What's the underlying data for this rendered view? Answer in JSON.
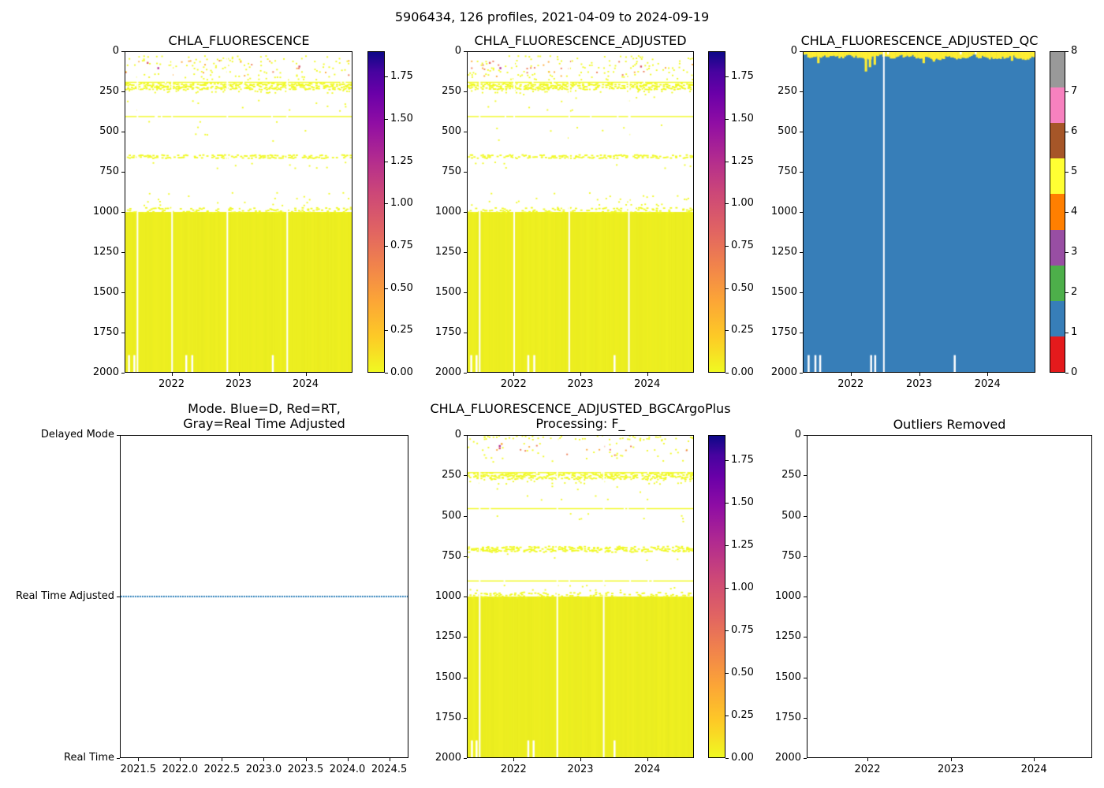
{
  "figure": {
    "suptitle": "5906434, 126 profiles, 2021-04-09 to 2024-09-19",
    "background": "#ffffff"
  },
  "colors": {
    "axis": "#000000",
    "heat_yellow": "#f0f921",
    "heat_block": "#eff021",
    "heat_stripe": "#dde41e",
    "qc_blue": "#377eb8",
    "qc_yellow": "#ffee33",
    "mode_blue": "#1f77b4",
    "plasma_stops": [
      [
        0,
        "#f0f921"
      ],
      [
        0.11,
        "#fdca26"
      ],
      [
        0.22,
        "#fca636"
      ],
      [
        0.33,
        "#f1844b"
      ],
      [
        0.44,
        "#e16462"
      ],
      [
        0.56,
        "#cc4778"
      ],
      [
        0.67,
        "#b12a90"
      ],
      [
        0.78,
        "#8f0da4"
      ],
      [
        0.87,
        "#6a00a8"
      ],
      [
        0.94,
        "#46039f"
      ],
      [
        1,
        "#0d0887"
      ]
    ],
    "set1": [
      "#e41a1c",
      "#377eb8",
      "#4daf4a",
      "#984ea3",
      "#ff7f00",
      "#ffff33",
      "#a65628",
      "#f781bf",
      "#999999"
    ]
  },
  "chart_data": [
    {
      "type": "heatmap",
      "title": "CHLA_FLUORESCENCE",
      "x_range": [
        2021.3,
        2024.7
      ],
      "y_range": [
        0,
        2000
      ],
      "n_profiles": 126,
      "seed": 11,
      "xticks": [
        2022,
        2023,
        2024
      ],
      "xtick_labels": [
        "2022",
        "2023",
        "2024"
      ],
      "yticks": [
        0,
        250,
        500,
        750,
        1000,
        1250,
        1500,
        1750,
        2000
      ],
      "ytick_labels": [
        "0",
        "250",
        "500",
        "750",
        "1000",
        "1250",
        "1500",
        "1750",
        "2000"
      ],
      "colorbar": {
        "vmin": 0,
        "vmax": 1.9,
        "tick_values": [
          0,
          0.25,
          0.5,
          0.75,
          1.0,
          1.25,
          1.5,
          1.75
        ],
        "tick_labels": [
          "0.00",
          "0.25",
          "0.50",
          "0.75",
          "1.00",
          "1.25",
          "1.50",
          "1.75"
        ],
        "colormap": "plasma_r"
      },
      "features": {
        "speck_bands": [
          {
            "y": [
              25,
              175
            ],
            "step": 14,
            "p": 0.09,
            "colors": [
              "#f0f921"
            ]
          },
          {
            "y": [
              55,
              150
            ],
            "step": 22,
            "p": 0.05,
            "colors": [
              "#fca636",
              "#ed7953",
              "#fca636"
            ]
          },
          {
            "y": [
              196,
              228
            ],
            "step": 10,
            "p": 0.55,
            "colors": [
              "#f0f921"
            ]
          },
          {
            "y": [
              228,
              250
            ],
            "step": 10,
            "p": 0.12,
            "colors": [
              "#f0f921"
            ]
          },
          {
            "y": [
              260,
              360
            ],
            "step": 20,
            "p": 0.02,
            "colors": [
              "#f0f921"
            ]
          },
          {
            "y": [
              430,
              560
            ],
            "step": 20,
            "p": 0.015,
            "colors": [
              "#f0f921"
            ]
          },
          {
            "y": [
              644,
              658
            ],
            "step": 12,
            "p": 0.55,
            "colors": [
              "#f0f921"
            ]
          },
          {
            "y": [
              690,
              735
            ],
            "step": 16,
            "p": 0.02,
            "colors": [
              "#f0f921"
            ]
          },
          {
            "y": [
              880,
              972
            ],
            "step": 18,
            "p": 0.045,
            "colors": [
              "#f0f921"
            ]
          },
          {
            "y": [
              974,
              1000
            ],
            "step": 12,
            "p": 0.3,
            "colors": [
              "#f0f921"
            ]
          }
        ],
        "points": [
          {
            "t": 2021.78,
            "d": 95,
            "c": "#b12a90"
          },
          {
            "t": 2021.62,
            "d": 62,
            "c": "#e16462"
          },
          {
            "t": 2023.9,
            "d": 85,
            "c": "#d8576b"
          }
        ],
        "hlines": [
          {
            "y": 186
          },
          {
            "y": 400
          }
        ],
        "block": {
          "y": [
            1000,
            2000
          ]
        },
        "gaps_full": [
          2021.47,
          2021.99,
          2022.82,
          2023.72
        ],
        "gaps_bottom": {
          "y": [
            1895,
            2000
          ],
          "t": [
            2021.34,
            2021.42,
            2022.2,
            2022.29,
            2023.5
          ]
        }
      }
    },
    {
      "type": "heatmap",
      "title": "CHLA_FLUORESCENCE_ADJUSTED",
      "x_range": [
        2021.3,
        2024.7
      ],
      "y_range": [
        0,
        2000
      ],
      "n_profiles": 126,
      "seed": 22,
      "xticks": [
        2022,
        2023,
        2024
      ],
      "xtick_labels": [
        "2022",
        "2023",
        "2024"
      ],
      "yticks": [
        0,
        250,
        500,
        750,
        1000,
        1250,
        1500,
        1750,
        2000
      ],
      "ytick_labels": [
        "0",
        "250",
        "500",
        "750",
        "1000",
        "1250",
        "1500",
        "1750",
        "2000"
      ],
      "colorbar": {
        "vmin": 0,
        "vmax": 1.9,
        "tick_values": [
          0,
          0.25,
          0.5,
          0.75,
          1.0,
          1.25,
          1.5,
          1.75
        ],
        "tick_labels": [
          "0.00",
          "0.25",
          "0.50",
          "0.75",
          "1.00",
          "1.25",
          "1.50",
          "1.75"
        ],
        "colormap": "plasma_r"
      },
      "features": {
        "speck_bands": [
          {
            "y": [
              25,
              175
            ],
            "step": 14,
            "p": 0.09,
            "colors": [
              "#f0f921"
            ]
          },
          {
            "y": [
              55,
              150
            ],
            "step": 22,
            "p": 0.05,
            "colors": [
              "#fca636",
              "#ed7953",
              "#fca636"
            ]
          },
          {
            "y": [
              196,
              228
            ],
            "step": 10,
            "p": 0.55,
            "colors": [
              "#f0f921"
            ]
          },
          {
            "y": [
              228,
              250
            ],
            "step": 10,
            "p": 0.12,
            "colors": [
              "#f0f921"
            ]
          },
          {
            "y": [
              260,
              360
            ],
            "step": 20,
            "p": 0.02,
            "colors": [
              "#f0f921"
            ]
          },
          {
            "y": [
              430,
              560
            ],
            "step": 20,
            "p": 0.015,
            "colors": [
              "#f0f921"
            ]
          },
          {
            "y": [
              644,
              658
            ],
            "step": 12,
            "p": 0.55,
            "colors": [
              "#f0f921"
            ]
          },
          {
            "y": [
              690,
              735
            ],
            "step": 16,
            "p": 0.02,
            "colors": [
              "#f0f921"
            ]
          },
          {
            "y": [
              880,
              972
            ],
            "step": 18,
            "p": 0.045,
            "colors": [
              "#f0f921"
            ]
          },
          {
            "y": [
              974,
              1000
            ],
            "step": 12,
            "p": 0.3,
            "colors": [
              "#f0f921"
            ]
          }
        ],
        "points": [
          {
            "t": 2021.78,
            "d": 95,
            "c": "#b12a90"
          },
          {
            "t": 2021.62,
            "d": 62,
            "c": "#e16462"
          },
          {
            "t": 2023.9,
            "d": 85,
            "c": "#d8576b"
          }
        ],
        "hlines": [
          {
            "y": 186
          },
          {
            "y": 400
          }
        ],
        "block": {
          "y": [
            1000,
            2000
          ]
        },
        "gaps_full": [
          2021.47,
          2021.99,
          2022.82,
          2023.72
        ],
        "gaps_bottom": {
          "y": [
            1895,
            2000
          ],
          "t": [
            2021.34,
            2021.42,
            2022.2,
            2022.29,
            2023.5
          ]
        }
      }
    },
    {
      "type": "heatmap_qc",
      "title": "CHLA_FLUORESCENCE_ADJUSTED_QC",
      "x_range": [
        2021.3,
        2024.7
      ],
      "y_range": [
        0,
        2000
      ],
      "n_profiles": 126,
      "xticks": [
        2022,
        2023,
        2024
      ],
      "xtick_labels": [
        "2022",
        "2023",
        "2024"
      ],
      "yticks": [
        0,
        250,
        500,
        750,
        1000,
        1250,
        1500,
        1750,
        2000
      ],
      "ytick_labels": [
        "0",
        "250",
        "500",
        "750",
        "1000",
        "1250",
        "1500",
        "1750",
        "2000"
      ],
      "colorbar": {
        "tick_labels": [
          "0",
          "1",
          "2",
          "3",
          "4",
          "5",
          "6",
          "7",
          "8"
        ],
        "discrete": true
      },
      "features": {
        "dominant_qc": 1,
        "surface_qc": 5,
        "top_band": {
          "min": 8,
          "max": 55
        },
        "spikes": [
          [
            2021.5,
            70
          ],
          [
            2022.2,
            122
          ],
          [
            2022.26,
            95
          ],
          [
            2022.33,
            80
          ],
          [
            2023.05,
            70
          ],
          [
            2023.2,
            60
          ],
          [
            2024.35,
            55
          ],
          [
            2024.55,
            50
          ]
        ],
        "notches": [
          2022.53,
          2023.6,
          2023.82
        ],
        "gaps_full": [
          2022.47
        ],
        "gaps_bottom": {
          "y": [
            1895,
            2000
          ],
          "t": [
            2021.36,
            2021.46,
            2021.53,
            2022.28,
            2022.34,
            2023.51
          ]
        }
      }
    },
    {
      "type": "mode",
      "title": "Mode. Blue=D, Red=RT,\nGray=Real Time Adjusted",
      "x_range": [
        2021.28,
        2024.73
      ],
      "xticks": [
        2021.5,
        2022.0,
        2022.5,
        2023.0,
        2023.5,
        2024.0,
        2024.5
      ],
      "xtick_labels": [
        "2021.5",
        "2022.0",
        "2022.5",
        "2023.0",
        "2023.5",
        "2024.0",
        "2024.5"
      ],
      "ycats": [
        "Delayed Mode",
        "Real Time Adjusted",
        "Real Time"
      ],
      "line": {
        "at": "Real Time Adjusted",
        "style": "dotted"
      }
    },
    {
      "type": "heatmap",
      "title": "CHLA_FLUORESCENCE_ADJUSTED_BGCArgoPlus\nProcessing: F_",
      "x_range": [
        2021.3,
        2024.7
      ],
      "y_range": [
        0,
        2000
      ],
      "n_profiles": 126,
      "seed": 33,
      "xticks": [
        2022,
        2023,
        2024
      ],
      "xtick_labels": [
        "2022",
        "2023",
        "2024"
      ],
      "yticks": [
        0,
        250,
        500,
        750,
        1000,
        1250,
        1500,
        1750,
        2000
      ],
      "ytick_labels": [
        "0",
        "250",
        "500",
        "750",
        "1000",
        "1250",
        "1500",
        "1750",
        "2000"
      ],
      "colorbar": {
        "vmin": 0,
        "vmax": 1.9,
        "tick_values": [
          0,
          0.25,
          0.5,
          0.75,
          1.0,
          1.25,
          1.5,
          1.75
        ],
        "tick_labels": [
          "0.00",
          "0.25",
          "0.50",
          "0.75",
          "1.00",
          "1.25",
          "1.50",
          "1.75"
        ],
        "colormap": "plasma_r"
      },
      "features": {
        "speck_bands": [
          {
            "y": [
              0,
              22
            ],
            "step": 8,
            "p": 0.15,
            "colors": [
              "#f0f921"
            ]
          },
          {
            "y": [
              30,
              160
            ],
            "step": 18,
            "p": 0.04,
            "colors": [
              "#f0f921"
            ]
          },
          {
            "y": [
              60,
              130
            ],
            "step": 26,
            "p": 0.03,
            "colors": [
              "#fca636",
              "#ed7953"
            ]
          },
          {
            "y": [
              232,
              268
            ],
            "step": 10,
            "p": 0.55,
            "colors": [
              "#f0f921"
            ]
          },
          {
            "y": [
              268,
              300
            ],
            "step": 12,
            "p": 0.1,
            "colors": [
              "#f0f921"
            ]
          },
          {
            "y": [
              310,
              390
            ],
            "step": 20,
            "p": 0.02,
            "colors": [
              "#f0f921"
            ]
          },
          {
            "y": [
              480,
              530
            ],
            "step": 16,
            "p": 0.015,
            "colors": [
              "#f0f921"
            ]
          },
          {
            "y": [
              688,
              715
            ],
            "step": 9,
            "p": 0.5,
            "colors": [
              "#f0f921"
            ]
          },
          {
            "y": [
              720,
              770
            ],
            "step": 16,
            "p": 0.015,
            "colors": [
              "#f0f921"
            ]
          },
          {
            "y": [
              930,
              968
            ],
            "step": 14,
            "p": 0.04,
            "colors": [
              "#f0f921"
            ]
          },
          {
            "y": [
              974,
              1000
            ],
            "step": 12,
            "p": 0.3,
            "colors": [
              "#f0f921"
            ]
          }
        ],
        "points": [
          {
            "t": 2021.77,
            "d": 58,
            "c": "#b12a90"
          },
          {
            "t": 2021.77,
            "d": 72,
            "c": "#d8576b"
          },
          {
            "t": 2021.8,
            "d": 45,
            "c": "#fca636"
          }
        ],
        "hlines": [
          {
            "y": 226
          },
          {
            "y": 450
          },
          {
            "y": 900
          }
        ],
        "block": {
          "y": [
            1000,
            2000
          ]
        },
        "gaps_full": [
          2021.47,
          2022.64,
          2023.34
        ],
        "gaps_bottom": {
          "y": [
            1895,
            2000
          ],
          "t": [
            2021.35,
            2021.42,
            2022.2,
            2022.28,
            2023.5
          ]
        }
      }
    },
    {
      "type": "empty",
      "title": "Outliers Removed",
      "x_range": [
        2021.27,
        2024.7
      ],
      "xticks": [
        2022,
        2023,
        2024
      ],
      "xtick_labels": [
        "2022",
        "2023",
        "2024"
      ],
      "yticks": [
        0,
        250,
        500,
        750,
        1000,
        1250,
        1500,
        1750,
        2000
      ],
      "ytick_labels": [
        "0",
        "250",
        "500",
        "750",
        "1000",
        "1250",
        "1500",
        "1750",
        "2000"
      ]
    }
  ]
}
